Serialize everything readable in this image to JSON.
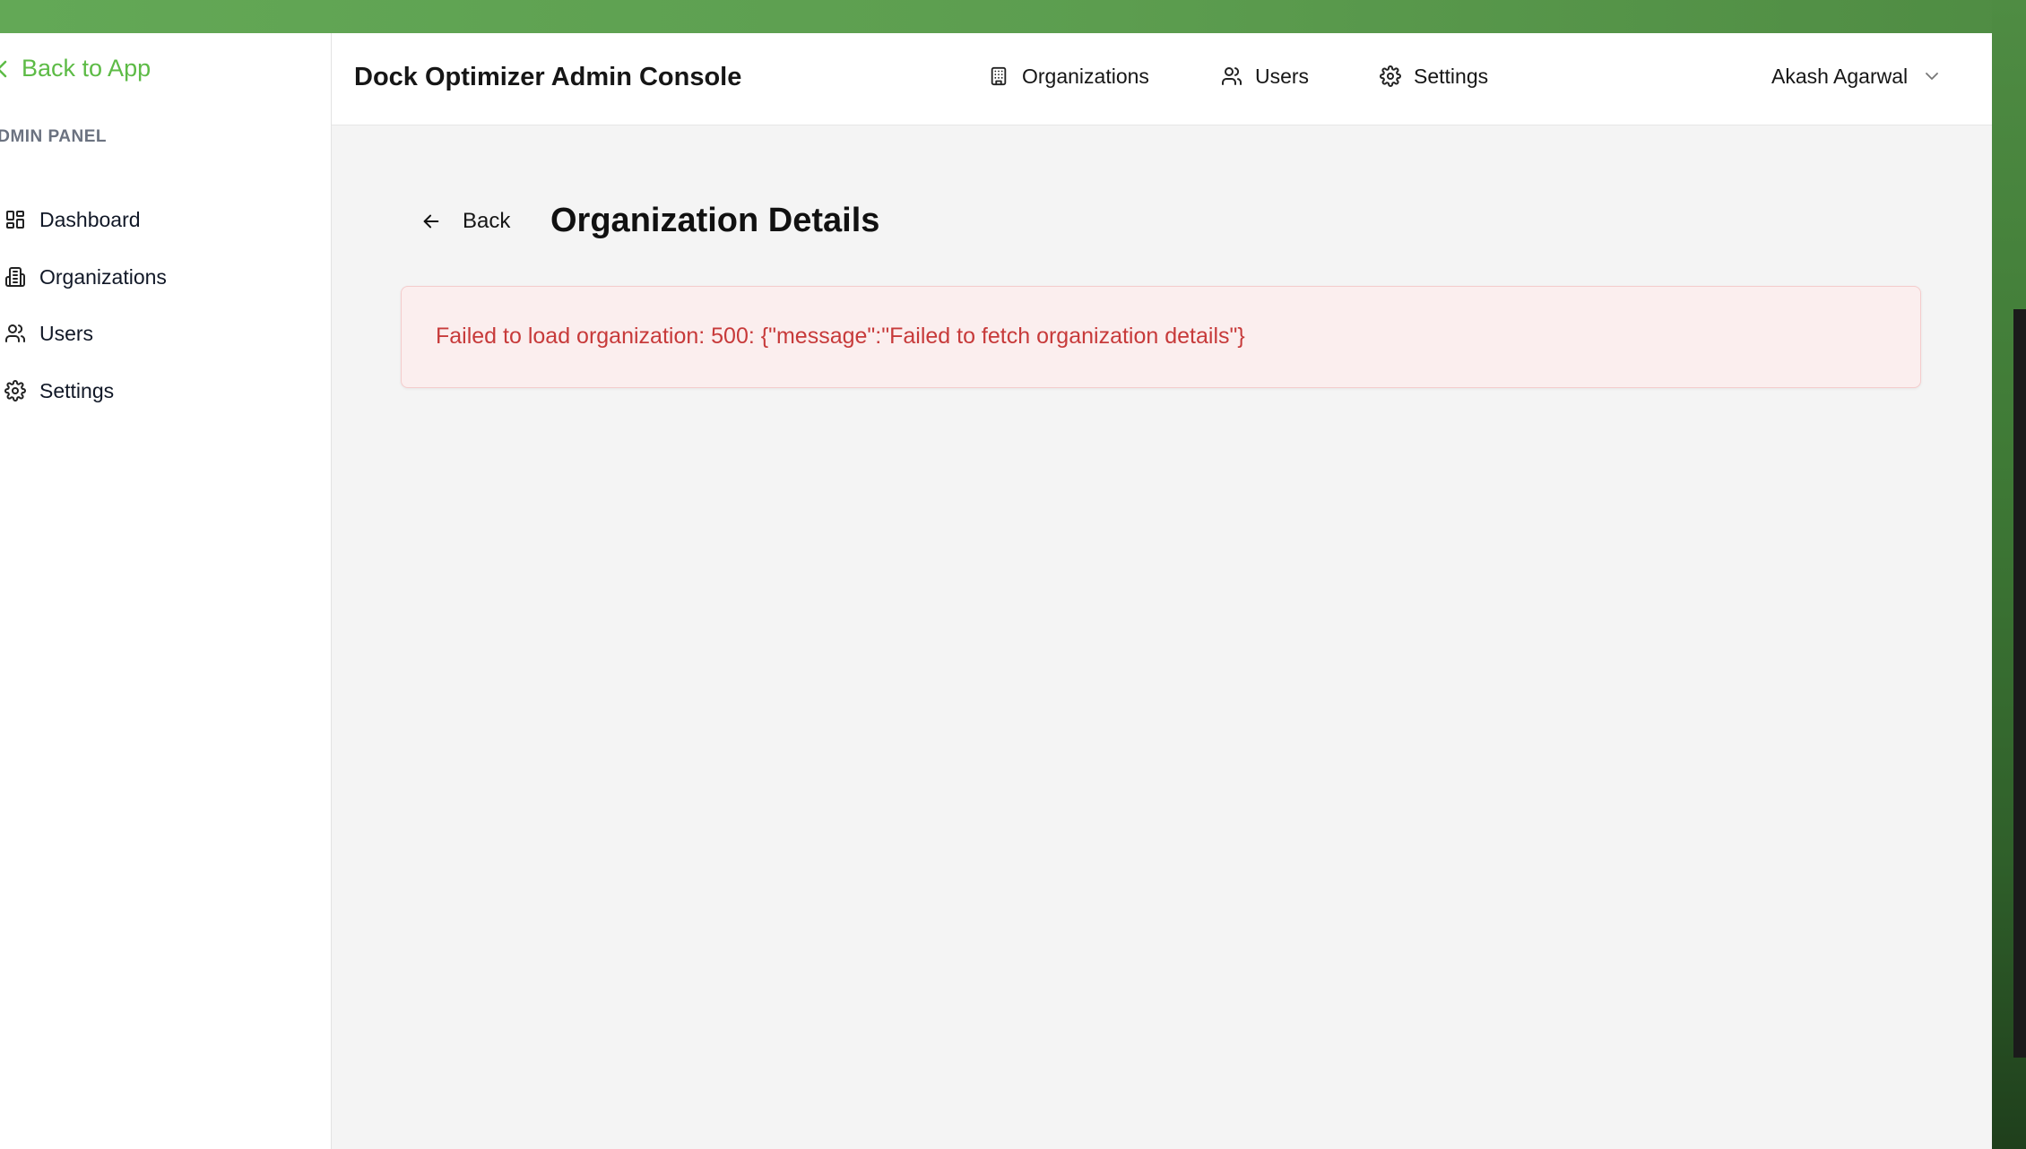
{
  "sidebar": {
    "back_label": "Back to App",
    "panel_label": "ADMIN PANEL",
    "items": [
      {
        "label": "Dashboard",
        "icon": "dashboard-grid-icon"
      },
      {
        "label": "Organizations",
        "icon": "building-icon"
      },
      {
        "label": "Users",
        "icon": "users-icon"
      },
      {
        "label": "Settings",
        "icon": "gear-icon"
      }
    ]
  },
  "header": {
    "title": "Dock Optimizer Admin Console",
    "nav": [
      {
        "label": "Organizations",
        "icon": "building-icon"
      },
      {
        "label": "Users",
        "icon": "users-icon"
      },
      {
        "label": "Settings",
        "icon": "gear-icon"
      }
    ],
    "user_name": "Akash Agarwal"
  },
  "main": {
    "back_label": "Back",
    "page_title": "Organization Details",
    "error_message": "Failed to load organization: 500: {\"message\":\"Failed to fetch organization details\"}"
  },
  "colors": {
    "accent_green": "#5dbb46",
    "error_text": "#c73a3a",
    "error_bg": "#fbeeee"
  }
}
